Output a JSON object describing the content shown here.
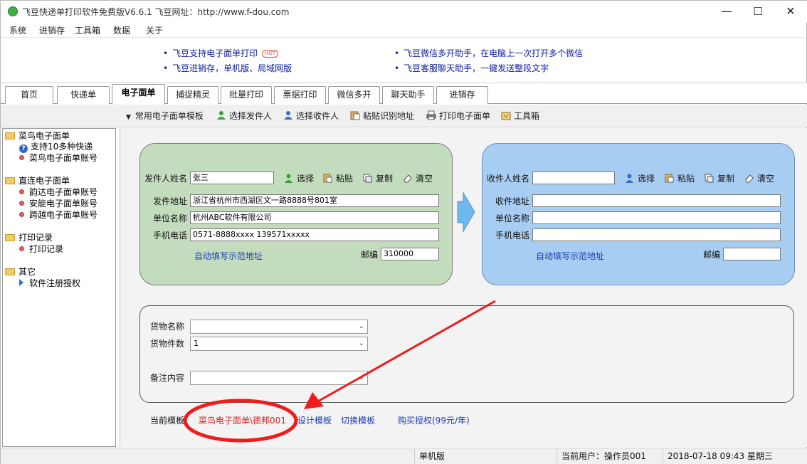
{
  "window": {
    "title": "飞豆快递单打印软件免费版V6.6.1  飞豆网址：http://www.f-dou.com",
    "min_glyph": "—",
    "max_glyph": "☐",
    "close_glyph": "✕"
  },
  "menu": [
    "系统",
    "进销存",
    "工具箱",
    "数据",
    "关于"
  ],
  "tips": [
    "飞豆支持电子面单打印",
    "飞豆进销存，单机版、局域网版",
    "飞豆微信多开助手，在电脑上一次打开多个微信",
    "飞豆客服聊天助手，一键发送整段文字"
  ],
  "hot_badge": "HOT",
  "tabs": [
    "首页",
    "快递单",
    "电子面单",
    "捕捉精灵",
    "批量打印",
    "票据打印",
    "微信多开",
    "聊天助手",
    "进销存"
  ],
  "active_tab": "电子面单",
  "toolbar": {
    "templates": "常用电子面单模板",
    "select_sender": "选择发件人",
    "select_receiver": "选择收件人",
    "paste_address": "粘贴识别地址",
    "print": "打印电子面单",
    "toolbox": "工具箱"
  },
  "tree": {
    "cainiao": "菜鸟电子面单",
    "cainiao_support": "支持10多种快递",
    "cainiao_account": "菜鸟电子面单账号",
    "direct": "直连电子面单",
    "yunda": "韵达电子面单账号",
    "anneng": "安能电子面单账号",
    "kuayue": "跨越电子面单账号",
    "print_records": "打印记录",
    "print_record_item": "打印记录",
    "other": "其它",
    "register": "软件注册授权"
  },
  "sender": {
    "name_label": "发件人姓名",
    "name": "张三",
    "address_label": "发件地址",
    "address": "浙江省杭州市西湖区文一路8888号801室",
    "company_label": "单位名称",
    "company": "杭州ABC软件有限公司",
    "phone_label": "手机电话",
    "phone": "0571-8888xxxx 139571xxxxx",
    "autofill": "自动填写示范地址",
    "zip_label": "邮编",
    "zip": "310000"
  },
  "receiver": {
    "name_label": "收件人姓名",
    "name": "",
    "address_label": "收件地址",
    "address": "",
    "company_label": "单位名称",
    "company": "",
    "phone_label": "手机电话",
    "phone": "",
    "autofill": "自动填写示范地址",
    "zip_label": "邮编",
    "zip": ""
  },
  "actions": {
    "select": "选择",
    "paste": "粘贴",
    "copy": "复制",
    "clear": "清空"
  },
  "goods": {
    "name_label": "货物名称",
    "name": "",
    "count_label": "货物件数",
    "count": "1",
    "note_label": "备注内容",
    "note": ""
  },
  "template_bar": {
    "label": "当前模板",
    "current": "菜鸟电子面单\\德邦001",
    "design": "设计模板",
    "switch": "切换模板",
    "buy": "购买授权(99元/年)"
  },
  "status": {
    "edition": "单机版",
    "user": "当前用户：操作员001",
    "datetime": "2018-07-18 09:43 星期三"
  },
  "colors": {
    "sender_panel": "#c3dcbe",
    "receiver_panel": "#a8cdf2",
    "link": "#1a3ab0",
    "highlight": "#e02020"
  }
}
